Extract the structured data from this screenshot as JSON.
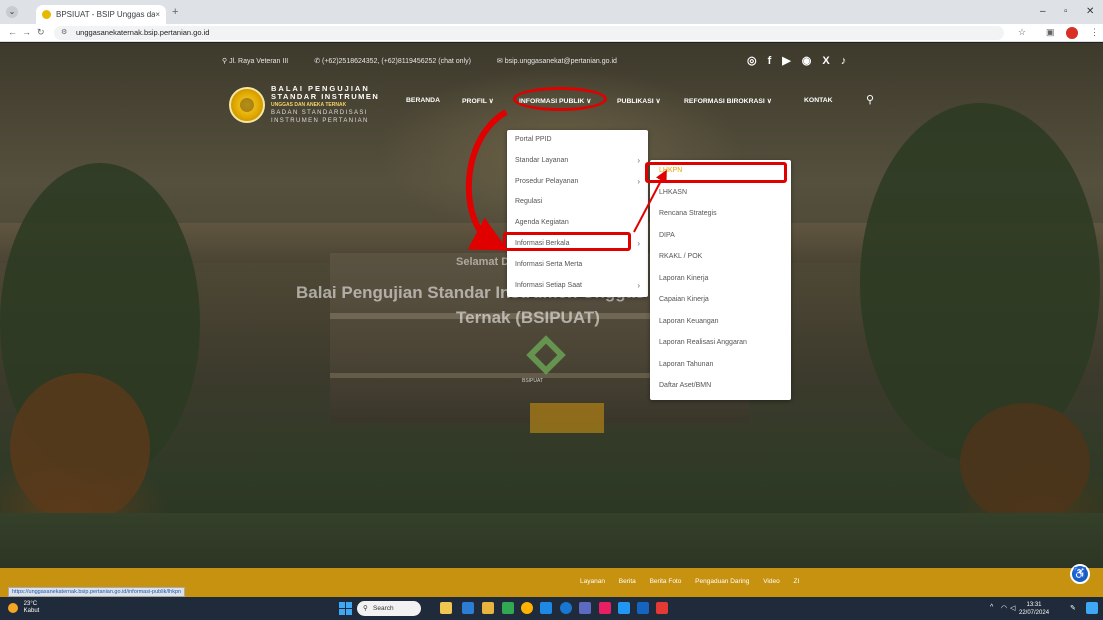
{
  "browser": {
    "tab_title": "BPSIUAT - BSIP Unggas dan A...",
    "tab_close": "×",
    "new_tab": "+",
    "url": "unggasanekaternak.bsip.pertanian.go.id",
    "window_controls": [
      "–",
      "▫",
      "✕"
    ]
  },
  "site": {
    "top_info": [
      "Jl. Raya Veteran III",
      "(+62)2518624352, (+62)8119456252 (chat only)",
      "bsip.unggasanekat@pertanian.go.id"
    ],
    "brand": {
      "line1": "BALAI PENGUJIAN",
      "line2": "STANDAR INSTRUMEN",
      "line3": "UNGGAS DAN ANEKA TERNAK",
      "line4": "BADAN STANDARDISASI",
      "line5": "INSTRUMEN PERTANIAN"
    },
    "nav": [
      "BERANDA",
      "PROFIL ∨",
      "INFORMASI PUBLIK ∨",
      "PUBLIKASI ∨",
      "REFORMASI BIROKRASI ∨",
      "KONTAK"
    ],
    "dropdown1": [
      "Portal PPID",
      "Standar Layanan",
      "Prosedur Pelayanan",
      "Regulasi",
      "Agenda Kegiatan",
      "Informasi Berkala",
      "Informasi Serta Merta",
      "Informasi Setiap Saat"
    ],
    "dropdown2": [
      "LHKPN",
      "LHKASN",
      "Rencana Strategis",
      "DIPA",
      "RKAKL / POK",
      "Laporan Kinerja",
      "Capaian Kinerja",
      "Laporan Keuangan",
      "Laporan Realisasi Anggaran",
      "Laporan Tahunan",
      "Daftar Aset/BMN"
    ],
    "hero_line0": "Selamat Datang di",
    "hero_line1": "Balai Pengujian Standar Instrumen Unggas dan Aneka",
    "hero_line2": "Ternak (BSIPUAT)",
    "center_logo_label": "BSIPUAT",
    "footer_links": [
      "Layanan",
      "Berita",
      "Berita Foto",
      "Pengaduan Daring",
      "Video",
      "ZI"
    ],
    "status_url": "https://unggasanekaternak.bsip.pertanian.go.id/informasi-publik/lhkpn"
  },
  "taskbar": {
    "temp": "23°C",
    "weather": "Kabut",
    "search": "Search",
    "time": "13:31",
    "date": "22/07/2024"
  },
  "colors": {
    "accent": "#c79210",
    "annotation": "#e00000",
    "active_item": "#e8a400"
  }
}
